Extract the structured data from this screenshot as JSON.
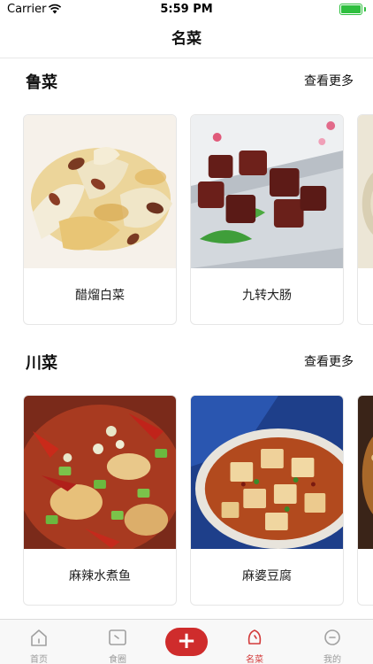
{
  "status_bar": {
    "carrier": "Carrier",
    "time": "5:59 PM",
    "battery_level": 1.0
  },
  "nav": {
    "title": "名菜"
  },
  "sections": [
    {
      "title": "鲁菜",
      "more_label": "查看更多",
      "dishes": [
        {
          "name": "醋熘白菜"
        },
        {
          "name": "九转大肠"
        }
      ]
    },
    {
      "title": "川菜",
      "more_label": "查看更多",
      "dishes": [
        {
          "name": "麻辣水煮鱼"
        },
        {
          "name": "麻婆豆腐"
        }
      ]
    }
  ],
  "tab_bar": {
    "items": [
      {
        "label": "首页",
        "icon": "home-icon"
      },
      {
        "label": "食圈",
        "icon": "circle-feed-icon"
      },
      {
        "label": "",
        "icon": "plus-icon"
      },
      {
        "label": "名菜",
        "icon": "famous-dish-icon",
        "active": true
      },
      {
        "label": "我的",
        "icon": "profile-icon"
      }
    ],
    "accent_color": "#cf2c2c"
  }
}
